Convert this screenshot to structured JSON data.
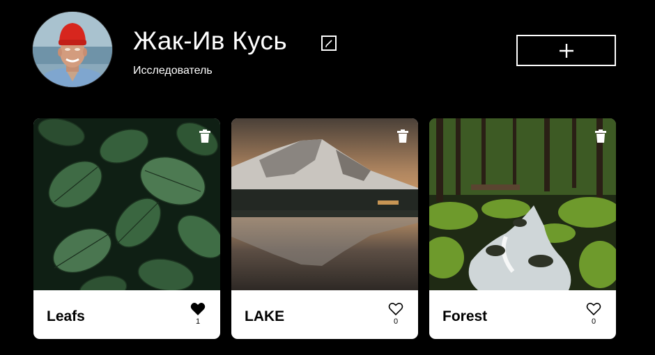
{
  "profile": {
    "name": "Жак-Ив Кусь",
    "role": "Исследователь",
    "avatar_icon": "explorer-portrait",
    "edit_icon": "pencil-edit-icon",
    "add_icon": "plus-icon"
  },
  "cards": [
    {
      "title": "Leafs",
      "likes": "1",
      "liked": true,
      "image": "green-leaves-photo"
    },
    {
      "title": "LAKE",
      "likes": "0",
      "liked": false,
      "image": "mountain-lake-photo"
    },
    {
      "title": "Forest",
      "likes": "0",
      "liked": false,
      "image": "mossy-forest-stream-photo"
    }
  ],
  "colors": {
    "background": "#000000",
    "card": "#ffffff",
    "text_light": "#ffffff",
    "text_dark": "#000000"
  }
}
